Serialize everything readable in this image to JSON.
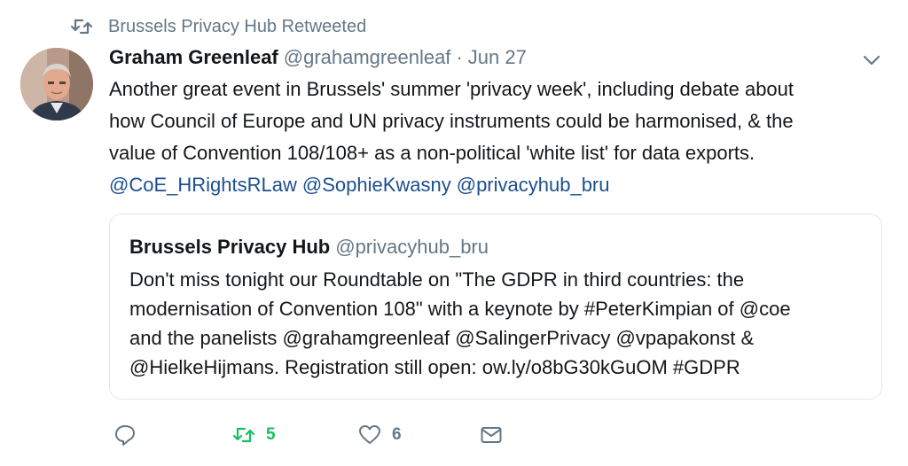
{
  "retweet_banner": {
    "text": "Brussels Privacy Hub Retweeted"
  },
  "tweet": {
    "author_name": "Graham Greenleaf",
    "author_handle": "@grahamgreenleaf",
    "separator": "·",
    "date": "Jun 27",
    "lines": [
      "Another great event in Brussels' summer 'privacy week', including debate about",
      "how Council of Europe and UN privacy instruments could be harmonised, & the",
      "value of Convention 108/108+ as a non-political 'white list' for data exports."
    ],
    "mentions": [
      "@CoE_HRightsRLaw",
      "@SophieKwasny",
      "@privacyhub_bru"
    ]
  },
  "quoted_tweet": {
    "author_name": "Brussels Privacy Hub",
    "author_handle": "@privacyhub_bru",
    "lines": [
      "Don't miss tonight our Roundtable on \"The GDPR in third countries: the",
      "modernisation of Convention 108\" with a keynote by #PeterKimpian of @coe",
      "and the panelists @grahamgreenleaf @SalingerPrivacy @vpapakonst &",
      "@HielkeHijmans. Registration still open: ow.ly/o8bG30kGuOM #GDPR"
    ]
  },
  "actions": {
    "reply_icon": "reply-icon",
    "retweet_icon": "retweet-icon",
    "retweet_count": "5",
    "like_icon": "heart-icon",
    "like_count": "6",
    "dm_icon": "envelope-icon"
  },
  "colors": {
    "text": "#14171a",
    "muted": "#657786",
    "mention": "#1b4f8f",
    "retweet_active": "#17bf63",
    "border": "#e1e8ed"
  }
}
